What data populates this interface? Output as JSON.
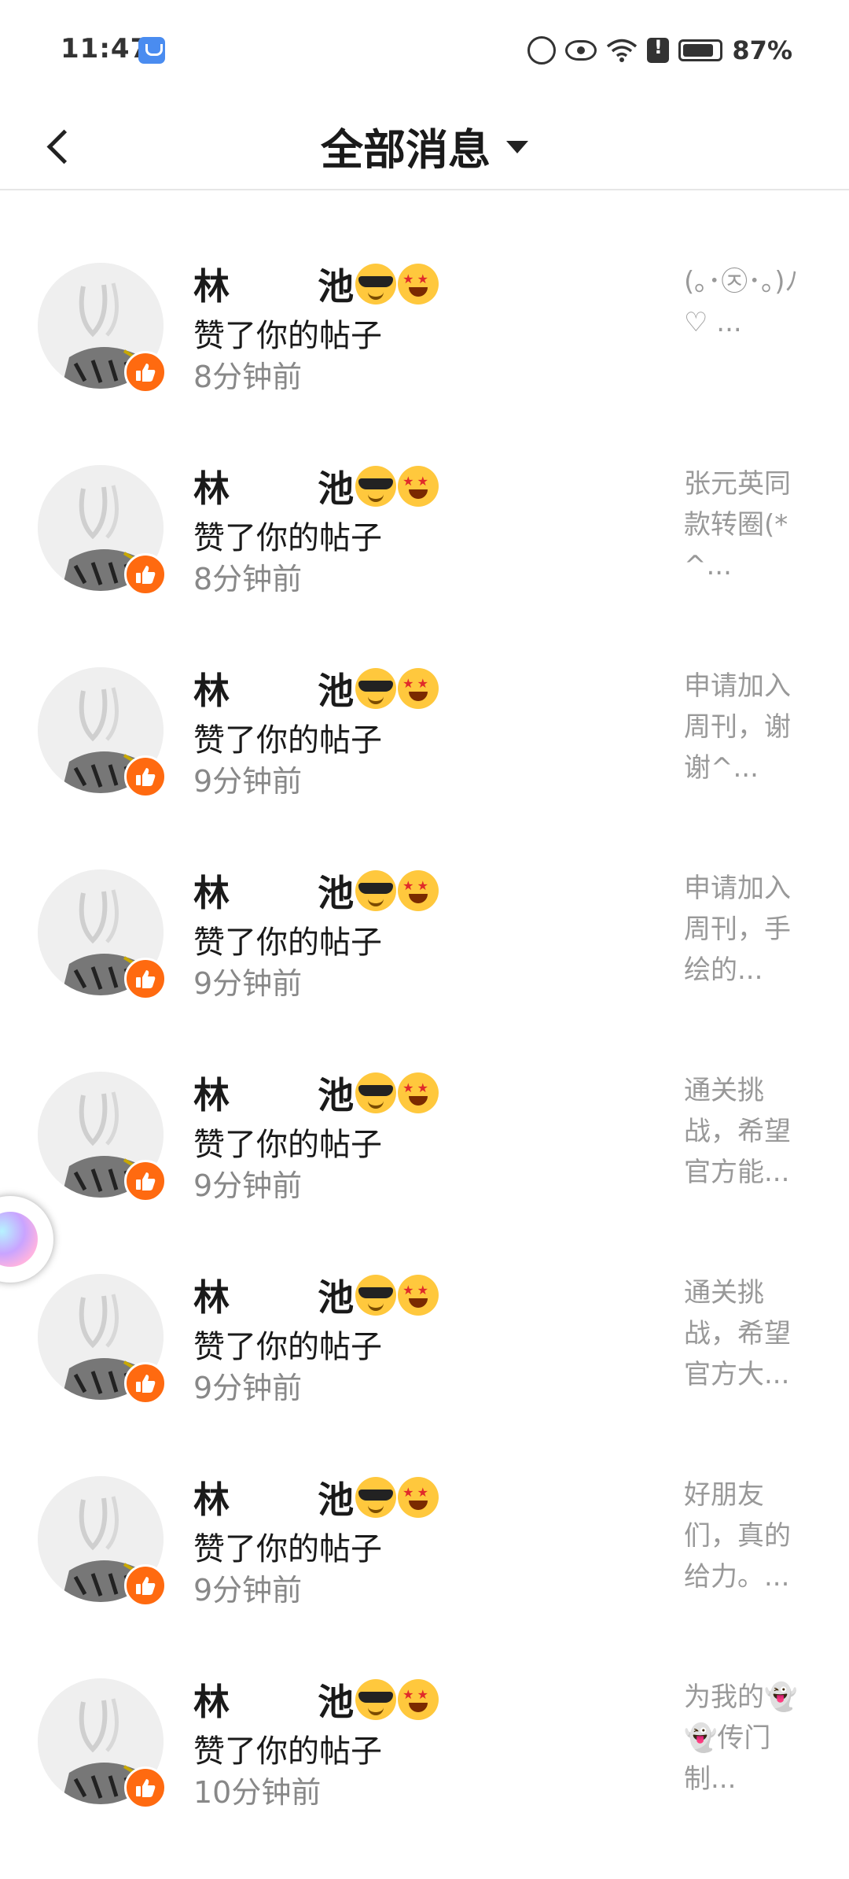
{
  "status_bar": {
    "time": "11:47",
    "battery": "87%"
  },
  "header": {
    "title": "全部消息"
  },
  "items": [
    {
      "name": "",
      "action": "赞了你的帖子",
      "time": "8分钟前",
      "preview": "♡ ..."
    },
    {
      "name": "林       池",
      "action": "赞了你的帖子",
      "time": "8分钟前",
      "preview": "(｡･㉨･｡)ﾉ♡ ..."
    },
    {
      "name": "林       池",
      "action": "赞了你的帖子",
      "time": "8分钟前",
      "preview": "张元英同款转圈(*^..."
    },
    {
      "name": "林       池",
      "action": "赞了你的帖子",
      "time": "9分钟前",
      "preview": "申请加入周刊，谢谢^..."
    },
    {
      "name": "林       池",
      "action": "赞了你的帖子",
      "time": "9分钟前",
      "preview": "申请加入周刊，手绘的..."
    },
    {
      "name": "林       池",
      "action": "赞了你的帖子",
      "time": "9分钟前",
      "preview": "通关挑战，希望官方能..."
    },
    {
      "name": "林       池",
      "action": "赞了你的帖子",
      "time": "9分钟前",
      "preview": "通关挑战，希望官方大..."
    },
    {
      "name": "林       池",
      "action": "赞了你的帖子",
      "time": "9分钟前",
      "preview": "好朋友们，真的给力。..."
    },
    {
      "name": "林       池",
      "action": "赞了你的帖子",
      "time": "10分钟前",
      "preview": "为我的👻👻传门制..."
    }
  ]
}
